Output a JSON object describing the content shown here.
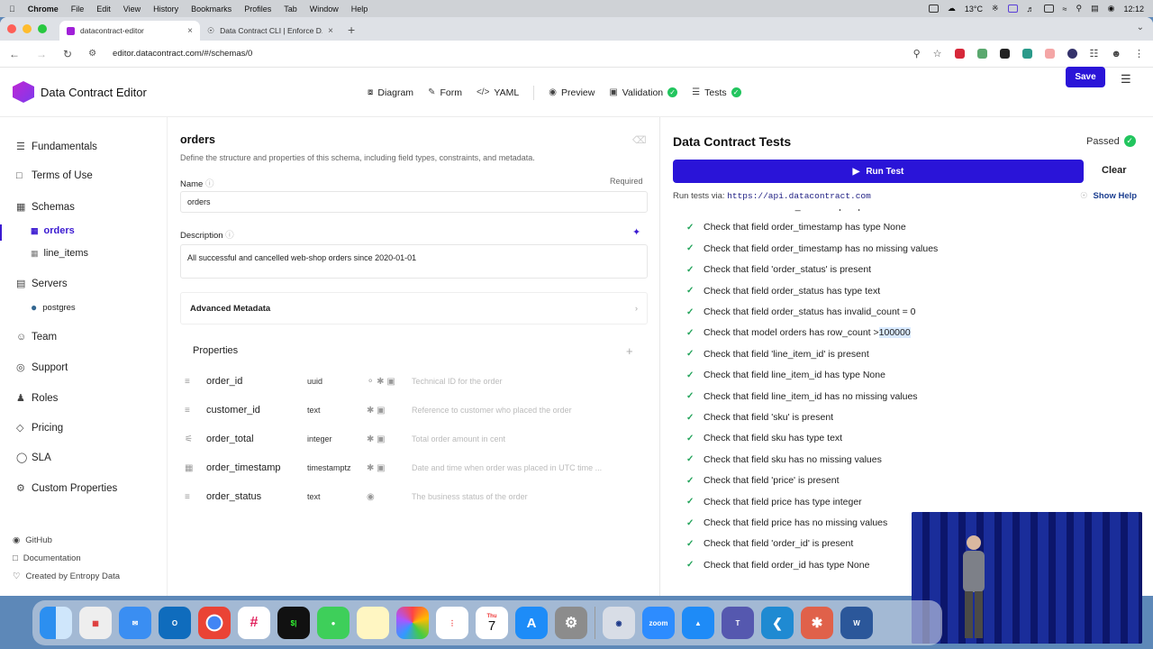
{
  "menubar": {
    "app": "Chrome",
    "items": [
      "File",
      "Edit",
      "View",
      "History",
      "Bookmarks",
      "Profiles",
      "Tab",
      "Window",
      "Help"
    ],
    "temperature": "13°C",
    "clock": "12:12"
  },
  "browser": {
    "tabs": [
      {
        "title": "datacontract-editor"
      },
      {
        "title": "Data Contract CLI | Enforce D..."
      }
    ],
    "url": "editor.datacontract.com/#/schemas/0"
  },
  "app": {
    "brand": "Data Contract Editor",
    "modes": [
      {
        "label": "Diagram",
        "icon": "diagram-icon"
      },
      {
        "label": "Form",
        "icon": "form-icon"
      },
      {
        "label": "YAML",
        "icon": "code-icon"
      },
      {
        "label": "Preview",
        "icon": "eye-icon"
      },
      {
        "label": "Validation",
        "icon": "validation-icon"
      },
      {
        "label": "Tests",
        "icon": "tests-icon"
      }
    ],
    "save_label": "Save"
  },
  "sidebar": {
    "items": [
      {
        "label": "Fundamentals",
        "icon": "list-icon"
      },
      {
        "label": "Terms of Use",
        "icon": "document-icon"
      },
      {
        "label": "Schemas",
        "icon": "table-icon"
      },
      {
        "label": "Servers",
        "icon": "server-icon"
      },
      {
        "label": "Team",
        "icon": "team-icon"
      },
      {
        "label": "Support",
        "icon": "support-icon"
      },
      {
        "label": "Roles",
        "icon": "roles-icon"
      },
      {
        "label": "Pricing",
        "icon": "pricing-icon"
      },
      {
        "label": "SLA",
        "icon": "sla-icon"
      },
      {
        "label": "Custom Properties",
        "icon": "gear-icon"
      }
    ],
    "schemas": [
      "orders",
      "line_items"
    ],
    "servers": [
      "postgres"
    ],
    "footer": [
      "GitHub",
      "Documentation",
      "Created by Entropy Data"
    ]
  },
  "schema": {
    "title": "orders",
    "subtitle": "Define the structure and properties of this schema, including field types, constraints, and metadata.",
    "name_label": "Name",
    "required_label": "Required",
    "name_value": "orders",
    "description_label": "Description",
    "description_value": "All successful and cancelled web-shop orders since 2020-01-01",
    "advanced_label": "Advanced Metadata",
    "properties_label": "Properties",
    "properties": [
      {
        "name": "order_id",
        "type": "uuid",
        "description": "Technical ID for the order"
      },
      {
        "name": "customer_id",
        "type": "text",
        "description": "Reference to customer who placed the order"
      },
      {
        "name": "order_total",
        "type": "integer",
        "description": "Total order amount in cent"
      },
      {
        "name": "order_timestamp",
        "type": "timestamptz",
        "description": "Date and time when order was placed in UTC time ..."
      },
      {
        "name": "order_status",
        "type": "text",
        "description": "The business status of the order"
      }
    ]
  },
  "tests": {
    "title": "Data Contract Tests",
    "status": "Passed",
    "run_label": "Run Test",
    "clear_label": "Clear",
    "via_prefix": "Run tests via:",
    "via_url": "https://api.datacontract.com",
    "help_label": "Show Help",
    "results": [
      "Check that field 'order_timestamp' is present",
      "Check that field order_timestamp has type None",
      "Check that field order_timestamp has no missing values",
      "Check that field 'order_status' is present",
      "Check that field order_status has type text",
      "Check that field order_status has invalid_count = 0",
      "Check that model orders has row_count > ",
      "Check that field 'line_item_id' is present",
      "Check that field line_item_id has type None",
      "Check that field line_item_id has no missing values",
      "Check that field 'sku' is present",
      "Check that field sku has type text",
      "Check that field sku has no missing values",
      "Check that field 'price' is present",
      "Check that field price has type integer",
      "Check that field price has no missing values",
      "Check that field 'order_id' is present",
      "Check that field order_id has type None"
    ],
    "highlighted_value": "100000"
  },
  "dock": {
    "calendar_month": "Thu",
    "calendar_day": "7",
    "zoom_label": "zoom"
  },
  "colors": {
    "accent": "#2a14d8",
    "success": "#22c55e",
    "active_nav": "#3b1ad1"
  }
}
